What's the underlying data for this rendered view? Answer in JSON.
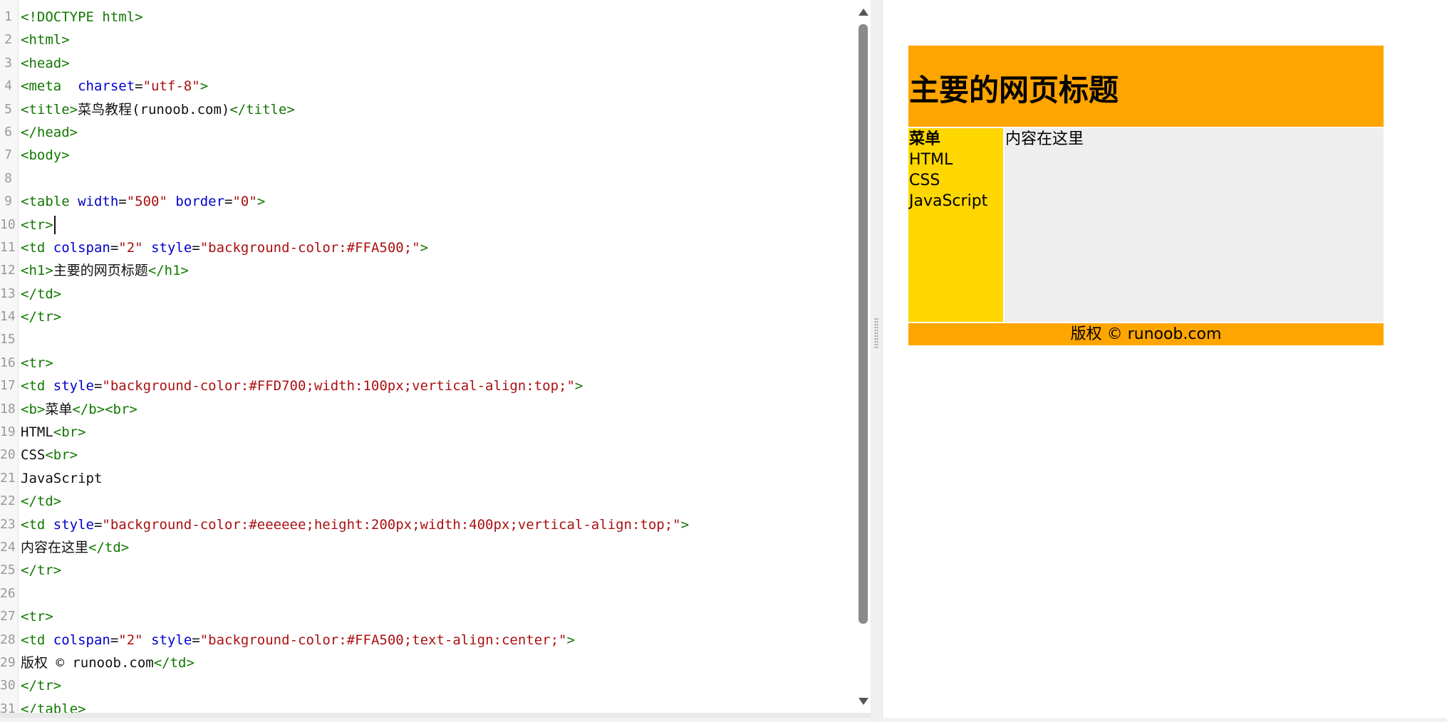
{
  "editor": {
    "lines": [
      {
        "n": "1",
        "tokens": [
          [
            "tag",
            "<!DOCTYPE html>"
          ]
        ]
      },
      {
        "n": "2",
        "tokens": [
          [
            "tag",
            "<html>"
          ]
        ]
      },
      {
        "n": "3",
        "tokens": [
          [
            "tag",
            "<head>"
          ]
        ]
      },
      {
        "n": "4",
        "tokens": [
          [
            "tag",
            "<meta  "
          ],
          [
            "attr",
            "charset"
          ],
          [
            "plain",
            "="
          ],
          [
            "str",
            "\"utf-8\""
          ],
          [
            "tag",
            ">"
          ]
        ]
      },
      {
        "n": "5",
        "tokens": [
          [
            "tag",
            "<title>"
          ],
          [
            "plain",
            "菜鸟教程(runoob.com)"
          ],
          [
            "tag",
            "</title>"
          ]
        ]
      },
      {
        "n": "6",
        "tokens": [
          [
            "tag",
            "</head>"
          ]
        ]
      },
      {
        "n": "7",
        "tokens": [
          [
            "tag",
            "<body>"
          ]
        ]
      },
      {
        "n": "8",
        "tokens": []
      },
      {
        "n": "9",
        "tokens": [
          [
            "tag",
            "<table "
          ],
          [
            "attr",
            "width"
          ],
          [
            "plain",
            "="
          ],
          [
            "str",
            "\"500\""
          ],
          [
            "plain",
            " "
          ],
          [
            "attr",
            "border"
          ],
          [
            "plain",
            "="
          ],
          [
            "str",
            "\"0\""
          ],
          [
            "tag",
            ">"
          ]
        ]
      },
      {
        "n": "10",
        "tokens": [
          [
            "tag",
            "<tr>"
          ]
        ],
        "cursor": true
      },
      {
        "n": "11",
        "tokens": [
          [
            "tag",
            "<td "
          ],
          [
            "attr",
            "colspan"
          ],
          [
            "plain",
            "="
          ],
          [
            "str",
            "\"2\""
          ],
          [
            "plain",
            " "
          ],
          [
            "attr",
            "style"
          ],
          [
            "plain",
            "="
          ],
          [
            "str",
            "\"background-color:#FFA500;\""
          ],
          [
            "tag",
            ">"
          ]
        ]
      },
      {
        "n": "12",
        "tokens": [
          [
            "tag",
            "<h1>"
          ],
          [
            "plain",
            "主要的网页标题"
          ],
          [
            "tag",
            "</h1>"
          ]
        ]
      },
      {
        "n": "13",
        "tokens": [
          [
            "tag",
            "</td>"
          ]
        ]
      },
      {
        "n": "14",
        "tokens": [
          [
            "tag",
            "</tr>"
          ]
        ]
      },
      {
        "n": "15",
        "tokens": []
      },
      {
        "n": "16",
        "tokens": [
          [
            "tag",
            "<tr>"
          ]
        ]
      },
      {
        "n": "17",
        "tokens": [
          [
            "tag",
            "<td "
          ],
          [
            "attr",
            "style"
          ],
          [
            "plain",
            "="
          ],
          [
            "str",
            "\"background-color:#FFD700;width:100px;vertical-align:top;\""
          ],
          [
            "tag",
            ">"
          ]
        ]
      },
      {
        "n": "18",
        "tokens": [
          [
            "tag",
            "<b>"
          ],
          [
            "plain",
            "菜单"
          ],
          [
            "tag",
            "</b><br>"
          ]
        ]
      },
      {
        "n": "19",
        "tokens": [
          [
            "plain",
            "HTML"
          ],
          [
            "tag",
            "<br>"
          ]
        ]
      },
      {
        "n": "20",
        "tokens": [
          [
            "plain",
            "CSS"
          ],
          [
            "tag",
            "<br>"
          ]
        ]
      },
      {
        "n": "21",
        "tokens": [
          [
            "plain",
            "JavaScript"
          ]
        ]
      },
      {
        "n": "22",
        "tokens": [
          [
            "tag",
            "</td>"
          ]
        ]
      },
      {
        "n": "23",
        "tokens": [
          [
            "tag",
            "<td "
          ],
          [
            "attr",
            "style"
          ],
          [
            "plain",
            "="
          ],
          [
            "str",
            "\"background-color:#eeeeee;height:200px;width:400px;vertical-align:top;\""
          ],
          [
            "tag",
            ">"
          ]
        ]
      },
      {
        "n": "24",
        "tokens": [
          [
            "plain",
            "内容在这里"
          ],
          [
            "tag",
            "</td>"
          ]
        ]
      },
      {
        "n": "25",
        "tokens": [
          [
            "tag",
            "</tr>"
          ]
        ]
      },
      {
        "n": "26",
        "tokens": []
      },
      {
        "n": "27",
        "tokens": [
          [
            "tag",
            "<tr>"
          ]
        ]
      },
      {
        "n": "28",
        "tokens": [
          [
            "tag",
            "<td "
          ],
          [
            "attr",
            "colspan"
          ],
          [
            "plain",
            "="
          ],
          [
            "str",
            "\"2\""
          ],
          [
            "plain",
            " "
          ],
          [
            "attr",
            "style"
          ],
          [
            "plain",
            "="
          ],
          [
            "str",
            "\"background-color:#FFA500;text-align:center;\""
          ],
          [
            "tag",
            ">"
          ]
        ]
      },
      {
        "n": "29",
        "tokens": [
          [
            "plain",
            "版权 © runoob.com"
          ],
          [
            "tag",
            "</td>"
          ]
        ]
      },
      {
        "n": "30",
        "tokens": [
          [
            "tag",
            "</tr>"
          ]
        ]
      },
      {
        "n": "31",
        "tokens": [
          [
            "tag",
            "</table>"
          ]
        ]
      }
    ]
  },
  "preview": {
    "header_title": "主要的网页标题",
    "menu": {
      "title": "菜单",
      "items": [
        "HTML",
        "CSS",
        "JavaScript"
      ]
    },
    "content_text": "内容在这里",
    "footer_text": "版权 © runoob.com"
  },
  "colors": {
    "header_bg": "#FFA500",
    "menu_bg": "#FFD700",
    "content_bg": "#eeeeee",
    "footer_bg": "#FFA500",
    "tag": "#117700",
    "attr": "#0000cc",
    "string": "#aa1111"
  }
}
